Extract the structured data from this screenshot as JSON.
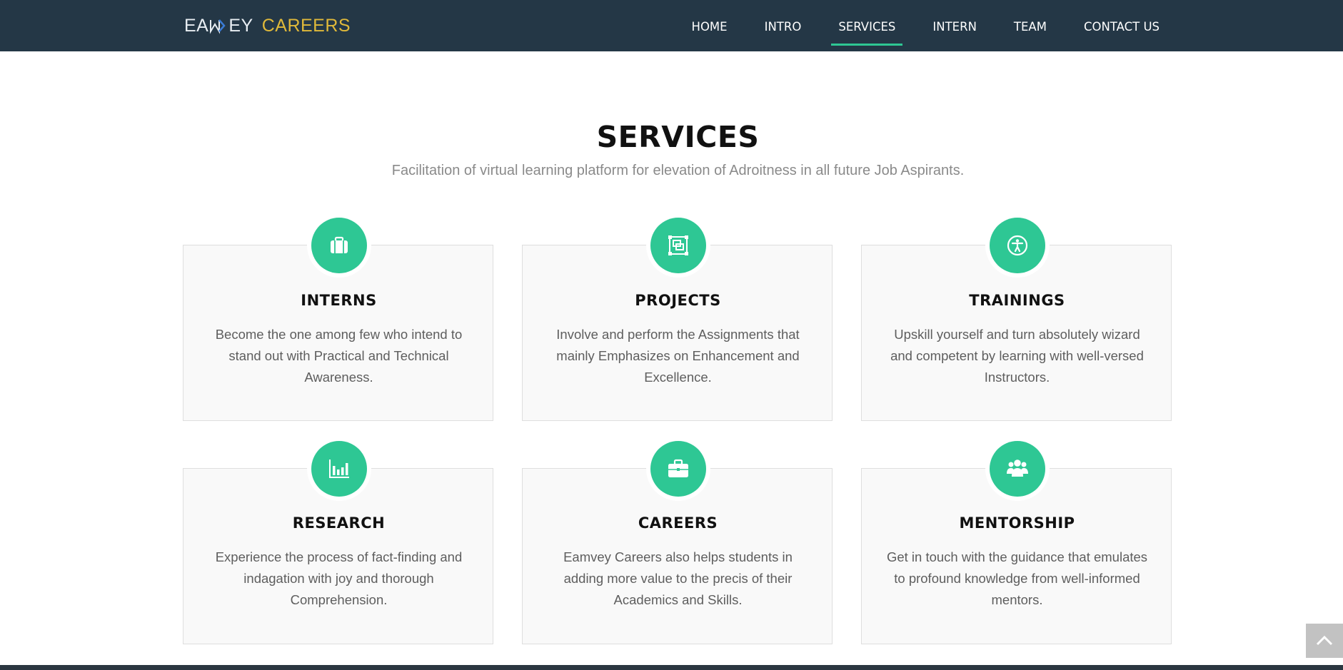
{
  "brand": {
    "logo_text_1": "EA",
    "logo_text_2": "EY",
    "logo_text_3": "CAREERS"
  },
  "nav": {
    "items": [
      "HOME",
      "INTRO",
      "SERVICES",
      "INTERN",
      "TEAM",
      "CONTACT US"
    ],
    "active": "SERVICES"
  },
  "services": {
    "title": "SERVICES",
    "subtitle": "Facilitation of virtual learning platform for elevation of Adroitness in all future Job Aspirants.",
    "cards": [
      {
        "title": "INTERNS",
        "icon": "suitcase-icon",
        "description": "Become the one among few who intend to stand out with Practical and Technical Awareness."
      },
      {
        "title": "PROJECTS",
        "icon": "object-group-icon",
        "description": "Involve and perform the Assignments that mainly Emphasizes on Enhancement and Excellence."
      },
      {
        "title": "TRAININGS",
        "icon": "accessibility-icon",
        "description": "Upskill yourself and turn absolutely wizard and competent by learning with well-versed Instructors."
      },
      {
        "title": "RESEARCH",
        "icon": "bar-chart-icon",
        "description": "Experience the process of fact-finding and indagation with joy and thorough Comprehension."
      },
      {
        "title": "CAREERS",
        "icon": "briefcase-icon",
        "description": "Eamvey Careers also helps students in adding more value to the precis of their Academics and Skills."
      },
      {
        "title": "MENTORSHIP",
        "icon": "users-icon",
        "description": "Get in touch with the guidance that emulates to profound knowledge from well-informed mentors."
      }
    ]
  },
  "colors": {
    "navbar": "#243746",
    "accent": "#2ec794",
    "logo_gold": "#e0b93a"
  },
  "scroll_top": {
    "icon": "chevron-up-icon"
  }
}
